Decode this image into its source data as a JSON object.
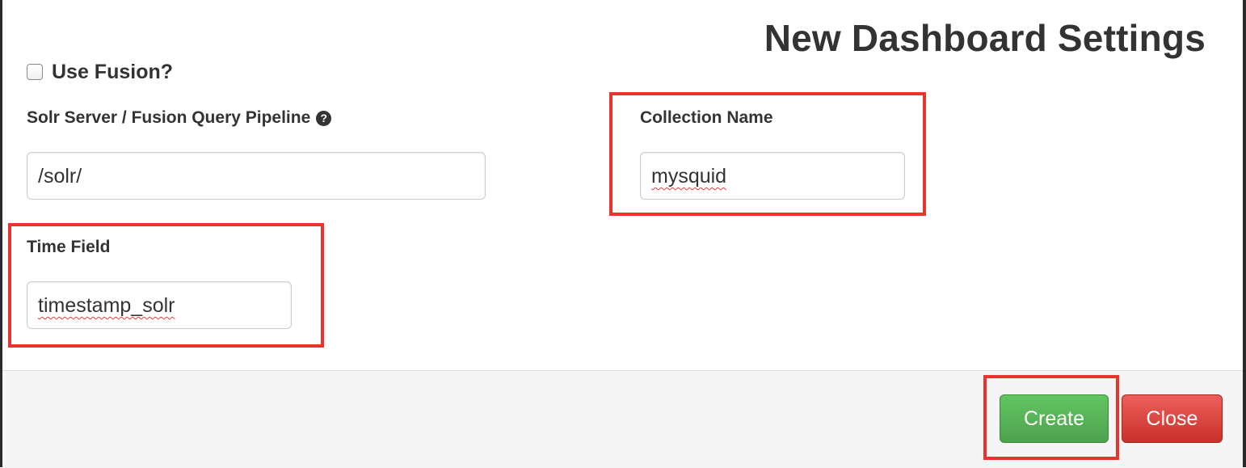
{
  "dialog": {
    "title": "New Dashboard Settings"
  },
  "use_fusion": {
    "label": "Use Fusion?",
    "checked": false
  },
  "solr_server": {
    "label": "Solr Server / Fusion Query Pipeline",
    "help_icon": "question-circle-icon",
    "value": "/solr/"
  },
  "collection_name": {
    "label": "Collection Name",
    "value": "mysquid"
  },
  "time_field": {
    "label": "Time Field",
    "value": "timestamp_solr"
  },
  "footer": {
    "create_label": "Create",
    "close_label": "Close"
  },
  "colors": {
    "highlight": "#e8342a",
    "create_button": "#5cb85c",
    "close_button": "#d9534f"
  }
}
